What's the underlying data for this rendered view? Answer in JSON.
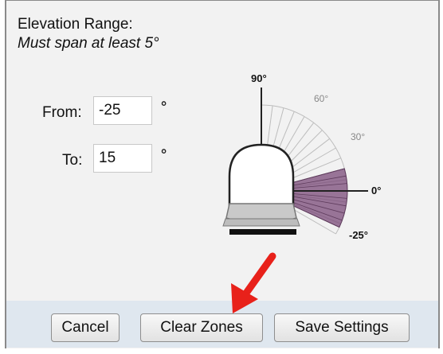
{
  "elevation": {
    "title": "Elevation Range:",
    "subtitle": "Must span at least 5°",
    "from_label": "From:",
    "from_value": "-25",
    "to_label": "To:",
    "to_value": "15",
    "unit_symbol": "°"
  },
  "diagram": {
    "label_90": "90°",
    "label_60": "60°",
    "label_30": "30°",
    "label_0": "0°",
    "label_neg25": "-25°",
    "range_color": "#7a4a78"
  },
  "buttons": {
    "cancel": "Cancel",
    "clear_zones": "Clear Zones",
    "save_settings": "Save Settings"
  },
  "annotation": {
    "arrow_color": "#e8211a",
    "arrow_icon": "red-arrow-icon"
  }
}
